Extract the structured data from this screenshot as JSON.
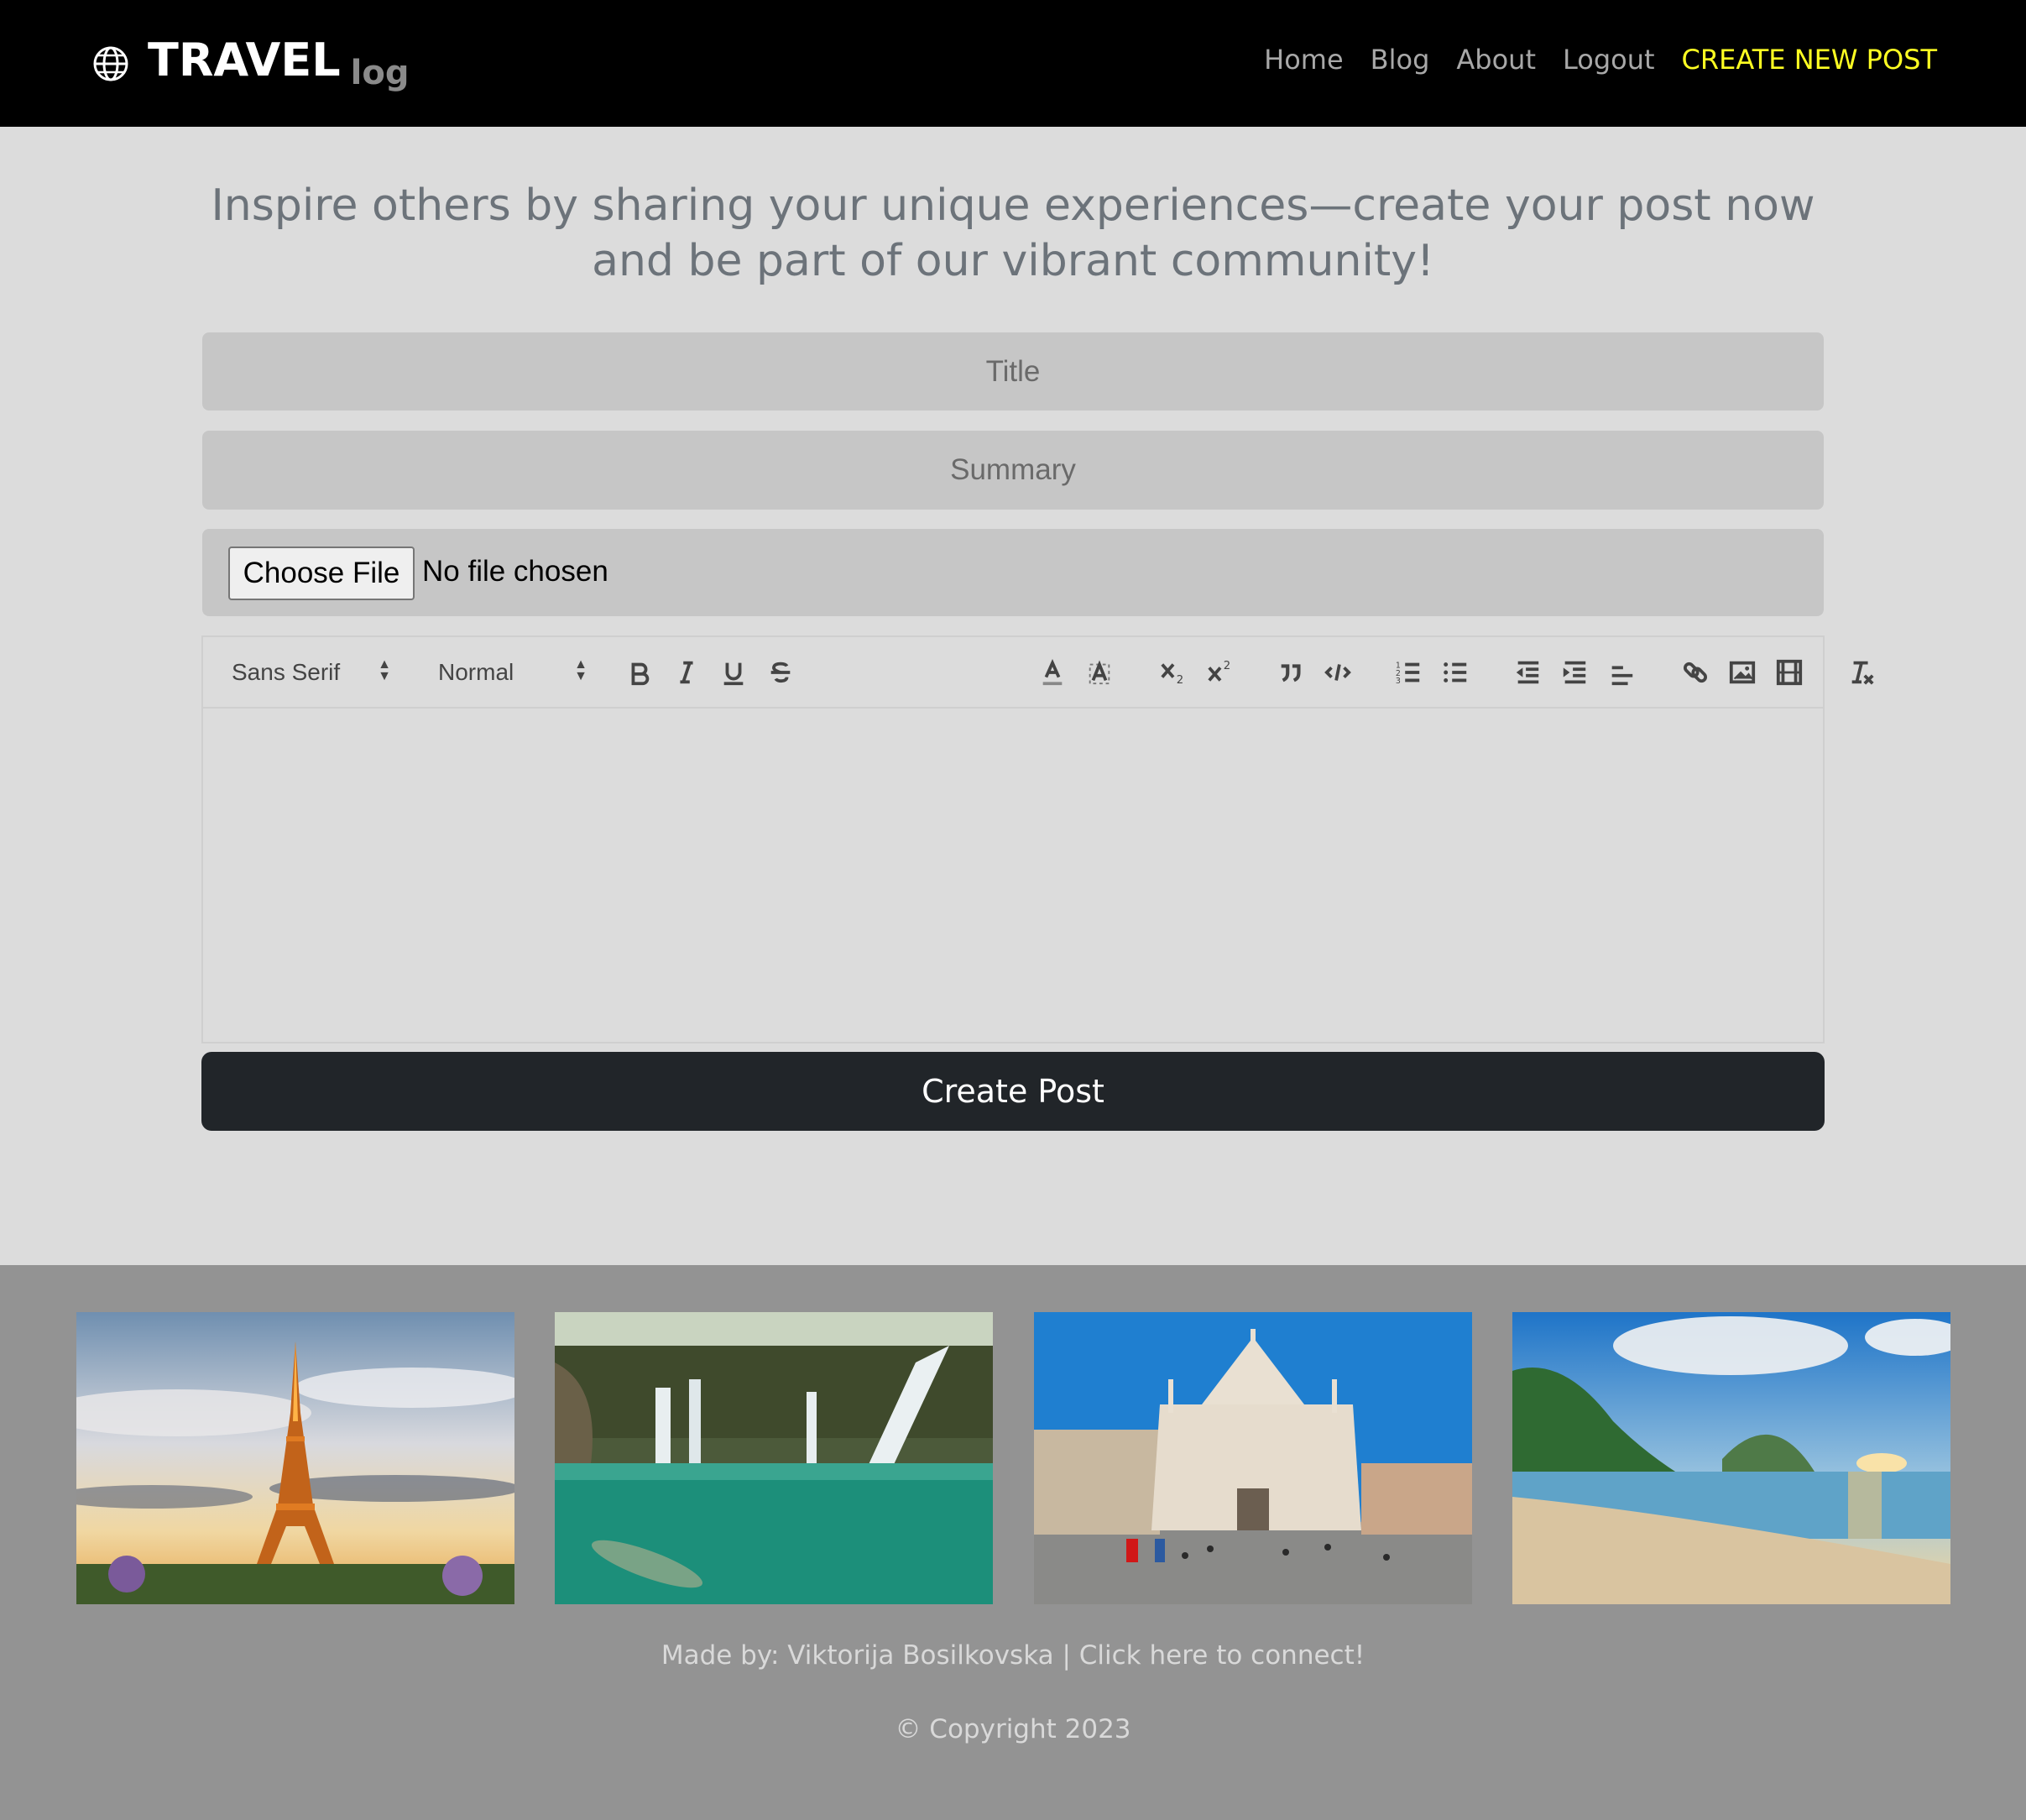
{
  "navbar": {
    "brand_main": "TRAVEL",
    "brand_sub": "log",
    "links": {
      "home": "Home",
      "blog": "Blog",
      "about": "About",
      "logout": "Logout",
      "create": "CREATE NEW POST"
    },
    "cta_color": "#ffff22",
    "globe_icon": "globe-icon"
  },
  "headline": "Inspire others by sharing your unique experiences—create your post now and be part of our vibrant community!",
  "form": {
    "title_placeholder": "Title",
    "summary_placeholder": "Summary",
    "file_button": "Choose File",
    "file_status": "No file chosen",
    "submit": "Create Post"
  },
  "editor": {
    "font_picker": "Sans Serif",
    "size_picker": "Normal",
    "toolbar_icons": [
      "bold-icon",
      "italic-icon",
      "underline-icon",
      "strike-icon",
      "text-color-icon",
      "background-color-icon",
      "subscript-icon",
      "superscript-icon",
      "blockquote-icon",
      "code-block-icon",
      "ordered-list-icon",
      "bullet-list-icon",
      "outdent-icon",
      "indent-icon",
      "align-icon",
      "link-icon",
      "image-icon",
      "video-icon",
      "clean-format-icon"
    ],
    "content": ""
  },
  "footer": {
    "gallery": [
      "eiffel-tower-photo",
      "waterfall-lake-photo",
      "milan-cathedral-photo",
      "tropical-beach-photo"
    ],
    "credits_prefix": "Made by: ",
    "credits_link": "Viktorija Bosilkovska | Click here to connect!",
    "copyright": "© Copyright 2023"
  },
  "colors": {
    "page_bg": "#dcdcdc",
    "navbar_bg": "#000000",
    "footer_bg": "#939393",
    "button_bg": "#212529"
  }
}
